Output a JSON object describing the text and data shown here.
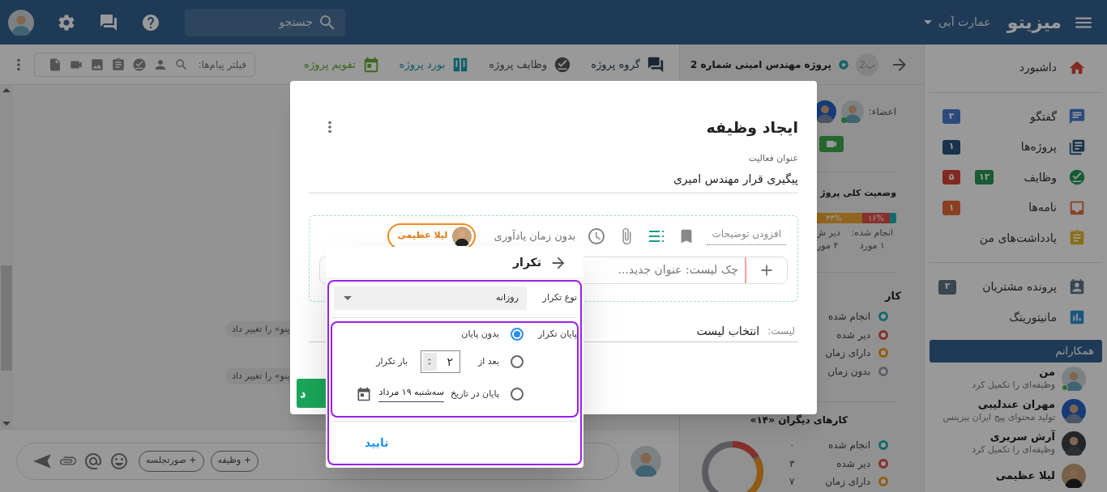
{
  "topbar": {
    "brand": "میزیتو",
    "workspace": "عمارت آبی",
    "search": {
      "placeholder": "جستجو"
    }
  },
  "sidebar": {
    "sections": [
      {
        "items": [
          {
            "kind": "home",
            "label": "داشبورد"
          }
        ]
      },
      {
        "items": [
          {
            "kind": "chat",
            "label": "گفتگو",
            "badges": [
              {
                "text": "۳",
                "color": "#2c4a7d"
              }
            ]
          },
          {
            "kind": "projects",
            "label": "پروژه‌ها",
            "badges": [
              {
                "text": "۱",
                "color": "#19334d"
              }
            ]
          },
          {
            "kind": "tasks",
            "label": "وظایف",
            "badges": [
              {
                "text": "۱۲",
                "color": "#195c33"
              },
              {
                "text": "۵",
                "color": "#822924"
              }
            ]
          },
          {
            "kind": "letters",
            "label": "نامه‌ها",
            "badges": [
              {
                "text": "۱",
                "color": "#8b4023"
              }
            ]
          },
          {
            "kind": "notes",
            "label": "یادداشت‌های من"
          }
        ]
      },
      {
        "items": [
          {
            "kind": "customers",
            "label": "پرونده مشتریان",
            "badges": [
              {
                "text": "۲",
                "color": "#394650"
              }
            ]
          },
          {
            "kind": "monitoring",
            "label": "مانیتورینگ"
          }
        ]
      }
    ]
  },
  "colleagues": {
    "title": "همکارانم",
    "people": [
      {
        "name": "من",
        "status": "وظیفه‌ای را تکمیل کرد",
        "online": true
      },
      {
        "name": "مهران عندلیبی",
        "status": "تولید محتوای پیج ایران بیزینس",
        "online": false
      },
      {
        "name": "آرش سریری",
        "status": "وظیفه‌ای را تکمیل کرد",
        "online": false
      },
      {
        "name": "لیلا عظیمی",
        "online": false
      }
    ]
  },
  "project": {
    "badge": "پ2",
    "title": "پروژه مهندس امینی شماره 2",
    "members_label": "اعضاء:",
    "status_title": "وضعیت کلی پروژ",
    "progress": [
      {
        "color": "#136a6a"
      },
      {
        "label": "۱۶%",
        "color": "#86302c"
      },
      {
        "label": "۳۳%",
        "color": "#90651d"
      }
    ],
    "stats": [
      {
        "label": "انجام شده:",
        "value": "۱ مورد"
      },
      {
        "label": "دیر ش",
        "value": "۴ مور"
      }
    ],
    "my_tasks": {
      "title": "کار",
      "legend": [
        {
          "label": "انجام شده",
          "color": "#136a6a"
        },
        {
          "label": "دیر شده",
          "color": "#86302c"
        },
        {
          "label": "دارای زمان",
          "color": "#905c13"
        },
        {
          "label": "بدون زمان",
          "color": "#606065"
        }
      ]
    },
    "others_tasks": {
      "title": "کارهای دیگران «۱۴»",
      "legend": [
        {
          "label": "انجام شده",
          "count": "۰",
          "color": "#136a6a"
        },
        {
          "label": "دیر شده",
          "count": "۳",
          "color": "#86302c"
        },
        {
          "label": "دارای زمان",
          "count": "۷",
          "color": "#905c13"
        }
      ]
    }
  },
  "chat": {
    "tabs": [
      {
        "kind": "group",
        "label": "گروه پروژه",
        "color": "#1a2633"
      },
      {
        "kind": "tasks",
        "label": "وظایف پروژه",
        "color": "#333333"
      },
      {
        "kind": "board",
        "label": "بورد پروژه",
        "color": "#105f6a"
      },
      {
        "kind": "calendar",
        "label": "تقویم پروژه",
        "color": "#39681c"
      }
    ],
    "filter_label": "فیلتر پیام‌ها:",
    "events": [
      "ینو» را تغییر داد",
      "ینو» را تغییر داد"
    ],
    "composer": {
      "buttons": [
        "+ وظیفه",
        "+ صورتجلسه"
      ]
    }
  },
  "modal": {
    "title": "ایجاد وظیفه",
    "field": {
      "label": "عنوان فعالیت",
      "value": "پیگیری قرار مهندس امیری"
    },
    "description": {
      "placeholder": "افزودن توضیحات"
    },
    "reminder": "بدون زمان یادآوری",
    "assignee": "لیلا عظیمی",
    "checklist": {
      "placeholder": "چک لیست: عنوان جدید..."
    },
    "list": {
      "label": "لیست:",
      "value": "انتخاب لیست"
    },
    "submit": "د"
  },
  "repeat_popup": {
    "title": "تکرار",
    "type_label": "نوع تکرار",
    "type_value": "روزانه",
    "end_label": "پایان تکرار",
    "options": [
      {
        "kind": "never",
        "label": "بدون پایان",
        "selected": true
      },
      {
        "kind": "after",
        "label": "بعد از",
        "count": "۲",
        "suffix": "بار تکرار",
        "selected": false
      },
      {
        "kind": "date",
        "label": "پایان در تاریخ",
        "date": "سه‌شنبه ۱۹ مرداد",
        "selected": false
      }
    ],
    "confirm": "تایید"
  }
}
